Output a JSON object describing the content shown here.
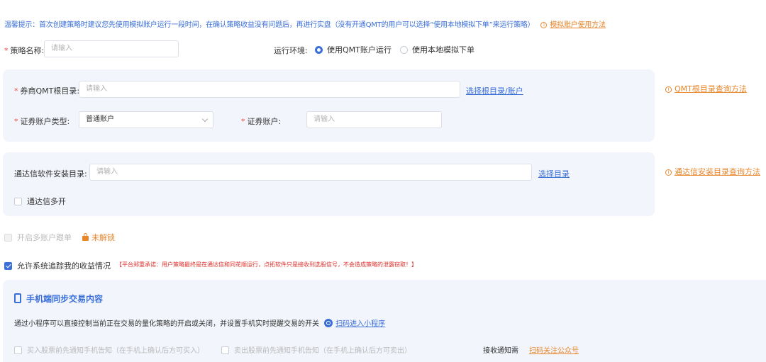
{
  "tip": {
    "text": "温馨提示：首次创建策略时建议您先使用模拟账户运行一段时间，在确认策略收益没有问题后，再进行实盘（没有开通QMT的用户可以选择“使用本地模拟下单”来运行策略）",
    "link": "模拟账户使用方法"
  },
  "strategy": {
    "label": "策略名称:",
    "placeholder": "请输入"
  },
  "env": {
    "label": "运行环境:",
    "options": [
      "使用QMT账户运行",
      "使用本地模拟下单"
    ],
    "selected": "使用QMT账户运行"
  },
  "qmt_panel": {
    "root_label": "券商QMT根目录:",
    "root_placeholder": "请输入",
    "select_link": "选择根目录/账户",
    "help_link": "QMT根目录查询方法",
    "account_type_label": "证券账户类型:",
    "account_type_value": "普通账户",
    "account_label": "证券账户:",
    "account_placeholder": "请输入"
  },
  "tdx_panel": {
    "label": "通达信软件安装目录:",
    "placeholder": "请输入",
    "select_link": "选择目录",
    "help_link": "通达信安装目录查询方法",
    "multi_label": "通达信多开"
  },
  "multi_account": {
    "label": "开启多账户跟单",
    "lock_text": "未解锁"
  },
  "tracking": {
    "label": "允许系统追踪我的收益情况",
    "note": "【平台郑重承诺：用户策略最终是在通达信和同花顺运行，点拓软件只是接收到选股信号，不会造成策略的泄露窃取！】"
  },
  "mobile": {
    "title": "手机端同步交易内容",
    "desc": "通过小程序可以直接控制当前正在交易的量化策略的开启或关闭，并设置手机实时提醒交易的开关",
    "scan_link": "扫码进入小程序",
    "buy_notify": "买入股票前先通知手机告知（在手机上确认后方可买入）",
    "sell_notify": "卖出股票前先通知手机告知（在手机上确认后方可卖出）",
    "receive_label": "接收通知需",
    "follow_link": "扫码关注公众号"
  },
  "colors": {
    "accent": "#3a6fd8",
    "link_orange": "#e8862c",
    "panel_bg": "#f3f5fc",
    "warning_red": "#e0302a"
  }
}
